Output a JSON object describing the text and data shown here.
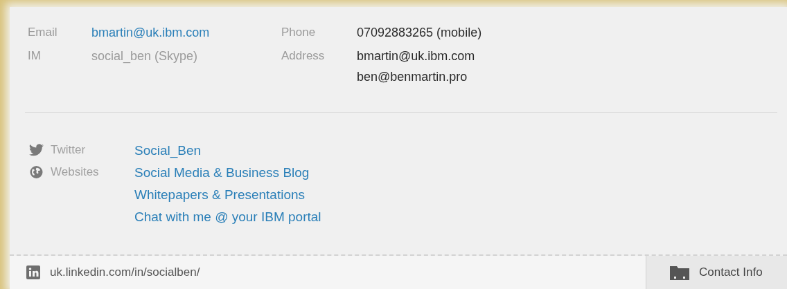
{
  "contact_columns": [
    [
      {
        "label": "Email",
        "values": [
          {
            "text": "bmartin@uk.ibm.com",
            "kind": "link"
          }
        ]
      },
      {
        "label": "IM",
        "values": [
          {
            "text": "social_ben (Skype)",
            "kind": "muted"
          }
        ]
      }
    ],
    [
      {
        "label": "Phone",
        "values": [
          {
            "text": "07092883265 (mobile)",
            "kind": "plain"
          }
        ]
      },
      {
        "label": "Address",
        "values": [
          {
            "text": "bmartin@uk.ibm.com",
            "kind": "plain"
          },
          {
            "text": "ben@benmartin.pro",
            "kind": "plain"
          }
        ]
      }
    ]
  ],
  "social": [
    {
      "kind": "twitter",
      "label": "Twitter",
      "links": [
        "Social_Ben"
      ]
    },
    {
      "kind": "globe",
      "label": "Websites",
      "links": [
        "Social Media & Business Blog",
        "Whitepapers & Presentations",
        "Chat with me @ your IBM portal"
      ]
    }
  ],
  "footer": {
    "profile_url": "uk.linkedin.com/in/socialben/",
    "tab": {
      "label": "Contact Info"
    }
  }
}
